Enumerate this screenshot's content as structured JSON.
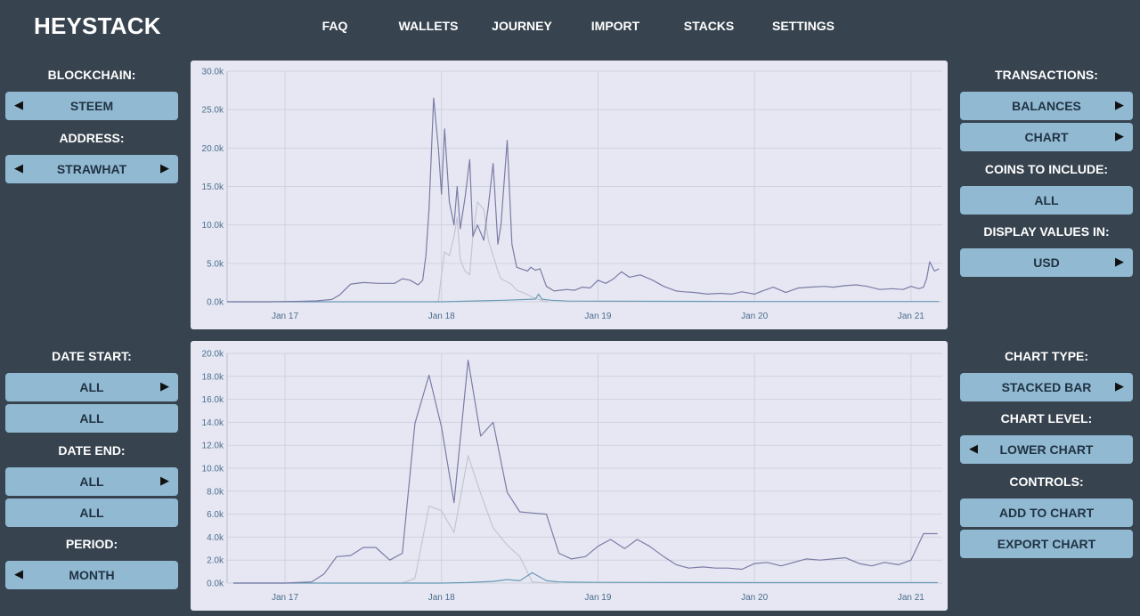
{
  "app": {
    "logo": "HEYSTACK"
  },
  "nav": [
    "FAQ",
    "WALLETS",
    "JOURNEY",
    "IMPORT",
    "STACKS",
    "SETTINGS"
  ],
  "left_panel": {
    "blockchain_label": "BLOCKCHAIN:",
    "blockchain_value": "STEEM",
    "address_label": "ADDRESS:",
    "address_value": "STRAWHAT",
    "date_start_label": "DATE START:",
    "date_start_value": "ALL",
    "date_start_sub": "ALL",
    "date_end_label": "DATE END:",
    "date_end_value": "ALL",
    "date_end_sub": "ALL",
    "period_label": "PERIOD:",
    "period_value": "MONTH"
  },
  "right_panel": {
    "transactions_label": "TRANSACTIONS:",
    "balances_button": "BALANCES",
    "chart_button": "CHART",
    "coins_label": "COINS TO INCLUDE:",
    "coins_value": "ALL",
    "display_label": "DISPLAY VALUES IN:",
    "display_value": "USD",
    "chart_type_label": "CHART TYPE:",
    "chart_type_value": "STACKED BAR",
    "chart_level_label": "CHART LEVEL:",
    "chart_level_value": "LOWER CHART",
    "controls_label": "CONTROLS:",
    "add_button": "ADD TO CHART",
    "export_button": "EXPORT CHART"
  },
  "arrows": {
    "left": "◀",
    "right": "▶"
  },
  "colors": {
    "background": "#37434f",
    "button": "#91b9d2",
    "chart_bg": "#e6e7f2",
    "series_dark": "#7b7ca6",
    "series_light": "#c3c5d0",
    "series_blue": "#6a9ab6"
  },
  "chart_data": [
    {
      "type": "line",
      "x_tick_labels": [
        "Jan 17",
        "Jan 18",
        "Jan 19",
        "Jan 20",
        "Jan 21"
      ],
      "y_tick_labels": [
        "0.0k",
        "5.0k",
        "10.0k",
        "15.0k",
        "20.0k",
        "25.0k",
        "30.0k"
      ],
      "ylim": [
        0,
        30000
      ],
      "xlim": [
        2016.63,
        2021.2
      ],
      "grid": true,
      "series": [
        {
          "color": "#7b7ca6",
          "x": [
            2016.63,
            2016.9,
            2017.0,
            2017.1,
            2017.2,
            2017.3,
            2017.35,
            2017.42,
            2017.5,
            2017.6,
            2017.7,
            2017.75,
            2017.8,
            2017.85,
            2017.88,
            2017.9,
            2017.92,
            2017.95,
            2017.98,
            2018.0,
            2018.02,
            2018.05,
            2018.08,
            2018.1,
            2018.12,
            2018.15,
            2018.18,
            2018.2,
            2018.23,
            2018.27,
            2018.3,
            2018.33,
            2018.36,
            2018.38,
            2018.42,
            2018.45,
            2018.48,
            2018.52,
            2018.55,
            2018.57,
            2018.6,
            2018.63,
            2018.67,
            2018.72,
            2018.8,
            2018.85,
            2018.9,
            2018.95,
            2019.0,
            2019.05,
            2019.1,
            2019.15,
            2019.2,
            2019.27,
            2019.35,
            2019.42,
            2019.5,
            2019.55,
            2019.62,
            2019.7,
            2019.78,
            2019.85,
            2019.92,
            2020.0,
            2020.05,
            2020.12,
            2020.2,
            2020.28,
            2020.35,
            2020.45,
            2020.5,
            2020.58,
            2020.65,
            2020.72,
            2020.8,
            2020.88,
            2020.95,
            2021.0,
            2021.05,
            2021.08,
            2021.1,
            2021.12,
            2021.15,
            2021.18
          ],
          "y": [
            0,
            0,
            30,
            60,
            120,
            300,
            900,
            2300,
            2500,
            2400,
            2400,
            3000,
            2800,
            2200,
            2800,
            6000,
            12000,
            26500,
            20000,
            14000,
            22500,
            13000,
            10000,
            15000,
            9500,
            13500,
            18500,
            8500,
            10000,
            8000,
            12500,
            18000,
            7500,
            10000,
            21000,
            7500,
            4500,
            4200,
            4000,
            4500,
            4100,
            4300,
            2000,
            1400,
            1600,
            1500,
            1900,
            1800,
            2800,
            2400,
            3000,
            3900,
            3200,
            3500,
            2800,
            2000,
            1400,
            1300,
            1200,
            1000,
            1100,
            1000,
            1300,
            1000,
            1400,
            1900,
            1200,
            1800,
            1900,
            2000,
            1900,
            2100,
            2200,
            2000,
            1600,
            1700,
            1600,
            2000,
            1700,
            1900,
            3000,
            5200,
            4000,
            4300
          ]
        },
        {
          "color": "#c3c5d0",
          "x": [
            2017.95,
            2017.98,
            2018.0,
            2018.02,
            2018.05,
            2018.08,
            2018.1,
            2018.12,
            2018.15,
            2018.18,
            2018.2,
            2018.23,
            2018.27,
            2018.3,
            2018.33,
            2018.36,
            2018.38,
            2018.42,
            2018.45,
            2018.48,
            2018.52,
            2018.55,
            2018.58,
            2018.62,
            2018.65,
            2018.68
          ],
          "y": [
            0,
            0,
            3500,
            6500,
            6000,
            8500,
            11000,
            5500,
            4000,
            3500,
            8500,
            13000,
            12000,
            8000,
            6000,
            4000,
            3000,
            2600,
            2200,
            1500,
            1200,
            900,
            600,
            300,
            100,
            0
          ]
        },
        {
          "color": "#6a9ab6",
          "x": [
            2016.63,
            2017.5,
            2018.0,
            2018.2,
            2018.4,
            2018.6,
            2018.62,
            2018.64,
            2018.7,
            2018.8,
            2019.0,
            2019.5,
            2020.0,
            2020.5,
            2021.0,
            2021.18
          ],
          "y": [
            0,
            0,
            0,
            100,
            200,
            350,
            1000,
            350,
            200,
            100,
            80,
            60,
            40,
            40,
            40,
            40
          ]
        }
      ]
    },
    {
      "type": "line",
      "x_tick_labels": [
        "Jan 17",
        "Jan 18",
        "Jan 19",
        "Jan 20",
        "Jan 21"
      ],
      "y_tick_labels": [
        "0.0k",
        "2.0k",
        "4.0k",
        "6.0k",
        "8.0k",
        "10.0k",
        "12.0k",
        "14.0k",
        "16.0k",
        "18.0k",
        "20.0k"
      ],
      "ylim": [
        0,
        20000
      ],
      "xlim": [
        2016.63,
        2021.2
      ],
      "grid": true,
      "series": [
        {
          "color": "#7b7ca6",
          "x": [
            2016.67,
            2016.75,
            2016.83,
            2016.92,
            2017.0,
            2017.08,
            2017.17,
            2017.25,
            2017.33,
            2017.42,
            2017.5,
            2017.58,
            2017.67,
            2017.75,
            2017.83,
            2017.92,
            2018.0,
            2018.08,
            2018.17,
            2018.25,
            2018.33,
            2018.42,
            2018.5,
            2018.58,
            2018.67,
            2018.75,
            2018.83,
            2018.92,
            2019.0,
            2019.08,
            2019.17,
            2019.25,
            2019.33,
            2019.42,
            2019.5,
            2019.58,
            2019.67,
            2019.75,
            2019.83,
            2019.92,
            2020.0,
            2020.08,
            2020.17,
            2020.25,
            2020.33,
            2020.42,
            2020.5,
            2020.58,
            2020.67,
            2020.75,
            2020.83,
            2020.92,
            2021.0,
            2021.08,
            2021.17
          ],
          "y": [
            0,
            0,
            0,
            0,
            0,
            50,
            100,
            800,
            2300,
            2400,
            3100,
            3100,
            2000,
            2600,
            13900,
            18100,
            13600,
            7000,
            19400,
            12800,
            14000,
            7900,
            6200,
            6100,
            6000,
            2600,
            2100,
            2300,
            3200,
            3800,
            3000,
            3800,
            3200,
            2300,
            1600,
            1300,
            1400,
            1300,
            1300,
            1200,
            1700,
            1800,
            1500,
            1800,
            2100,
            2000,
            2100,
            2200,
            1700,
            1500,
            1800,
            1600,
            2000,
            4300,
            4300
          ]
        },
        {
          "color": "#c3c5d0",
          "x": [
            2017.75,
            2017.83,
            2017.92,
            2018.0,
            2018.08,
            2018.17,
            2018.25,
            2018.33,
            2018.42,
            2018.5,
            2018.58,
            2018.67,
            2018.75
          ],
          "y": [
            0,
            400,
            6700,
            6300,
            4400,
            11100,
            7800,
            4800,
            3300,
            2300,
            100,
            0,
            0
          ]
        },
        {
          "color": "#6a9ab6",
          "x": [
            2016.67,
            2017.5,
            2017.83,
            2018.0,
            2018.17,
            2018.33,
            2018.42,
            2018.5,
            2018.58,
            2018.67,
            2018.75,
            2018.83,
            2019.0,
            2019.5,
            2020.0,
            2020.5,
            2021.0,
            2021.17
          ],
          "y": [
            0,
            0,
            0,
            0,
            50,
            150,
            300,
            200,
            900,
            200,
            100,
            80,
            60,
            50,
            40,
            40,
            40,
            40
          ]
        }
      ]
    }
  ]
}
